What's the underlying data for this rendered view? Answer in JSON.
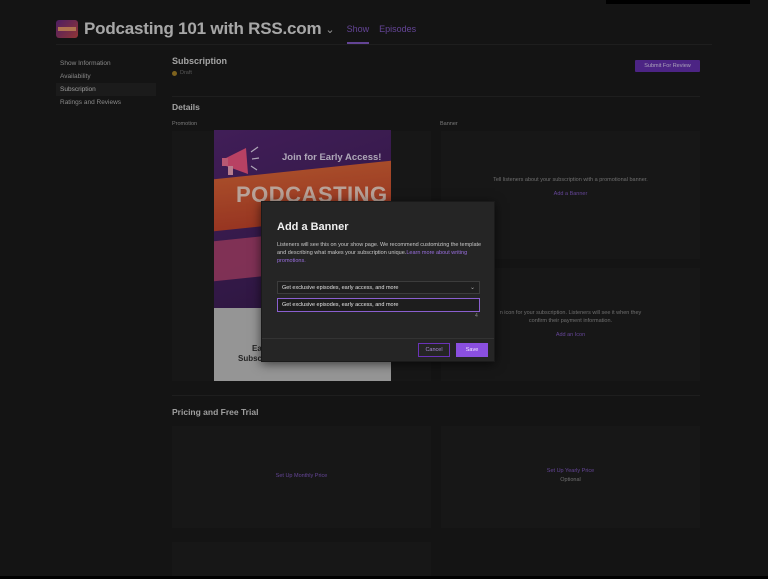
{
  "header": {
    "show_title": "Podcasting 101 with RSS.com",
    "tabs": [
      {
        "label": "Show",
        "active": true
      },
      {
        "label": "Episodes",
        "active": false
      }
    ]
  },
  "sidebar": {
    "items": [
      {
        "label": "Show Information",
        "active": false
      },
      {
        "label": "Availability",
        "active": false
      },
      {
        "label": "Subscription",
        "active": true
      },
      {
        "label": "Ratings and Reviews",
        "active": false
      }
    ]
  },
  "subscription": {
    "title": "Subscription",
    "status": "Draft",
    "submit_button": "Submit For Review"
  },
  "details": {
    "title": "Details",
    "promotion_label": "Promotion",
    "banner_label": "Banner",
    "banner_panel_text": "Tell listeners about your subscription with a promotional banner.",
    "banner_panel_link": "Add a Banner",
    "icon_panel_text_1": "n icon for your subscription. Listeners will see it when they",
    "icon_panel_text_2": "confirm their payment information.",
    "icon_panel_link": "Add an Icon"
  },
  "promo_image": {
    "join_text": "Join for Early Access!",
    "word": "PODCASTING",
    "bottom_1": "Ea",
    "bottom_2": "Subsc"
  },
  "modal": {
    "title": "Add a Banner",
    "description": "Listeners will see this on your show page. We recommend customizing the template and describing what makes your subscription unique.",
    "learn_more_link": "Learn more about writing promotions.",
    "select_value": "Get exclusive episodes, early access, and more",
    "input_value": "Get exclusive episodes, early access, and more",
    "counter": "4",
    "cancel_label": "Cancel",
    "save_label": "Save"
  },
  "pricing": {
    "title": "Pricing and Free Trial",
    "monthly_link": "Set Up Monthly Price",
    "yearly_link": "Set Up Yearly Price",
    "yearly_sub": "Optional"
  },
  "colors": {
    "accent": "#8a5fcf",
    "background": "#1c1c1c",
    "panel": "#212121"
  }
}
